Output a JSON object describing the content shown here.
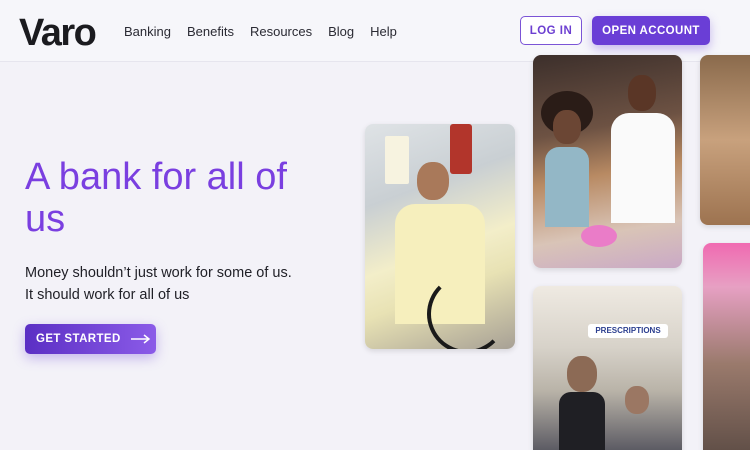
{
  "header": {
    "logo": "Varo",
    "nav": [
      "Banking",
      "Benefits",
      "Resources",
      "Blog",
      "Help"
    ],
    "login_label": "LOG IN",
    "open_account_label": "OPEN ACCOUNT"
  },
  "hero": {
    "title": "A bank for all of us",
    "subtitle_line1": "Money shouldn’t just work for some of us.",
    "subtitle_line2": "It should work for all of us",
    "cta_label": "GET STARTED"
  },
  "photos": {
    "pharmacy_sign": "PRESCRIPTIONS"
  },
  "colors": {
    "accent": "#6a3ed6",
    "title": "#7a3fe0",
    "background": "#f3f2f8"
  }
}
